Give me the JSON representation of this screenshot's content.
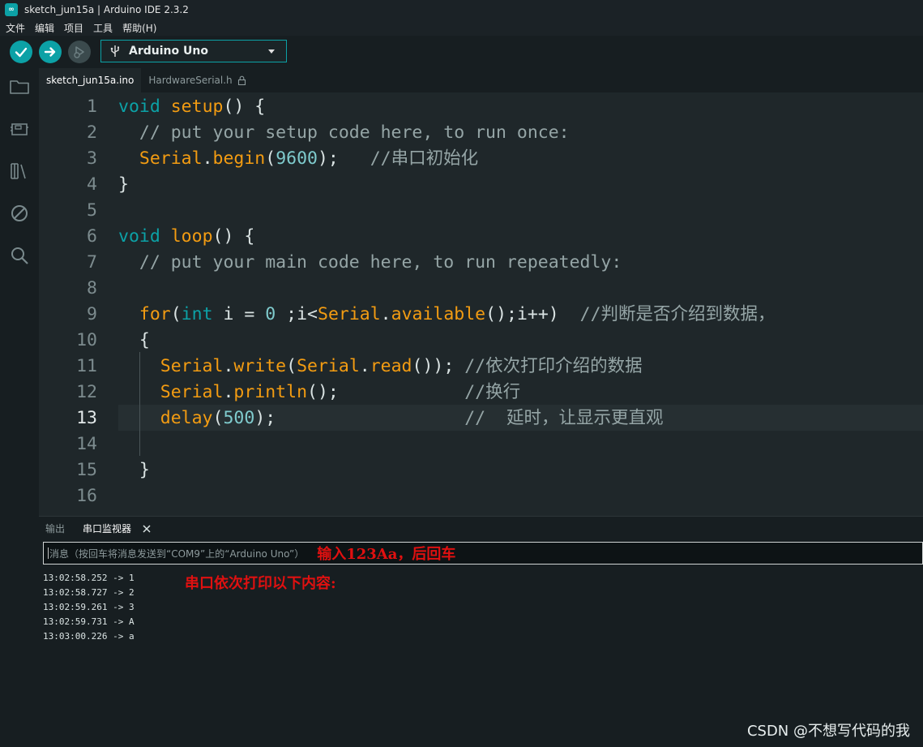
{
  "window": {
    "title": "sketch_jun15a | Arduino IDE 2.3.2"
  },
  "menu": [
    "文件",
    "编辑",
    "项目",
    "工具",
    "帮助(H)"
  ],
  "toolbar": {
    "board": "Arduino Uno"
  },
  "tabs": [
    {
      "label": "sketch_jun15a.ino",
      "active": true
    },
    {
      "label": "HardwareSerial.h",
      "active": false,
      "locked": true
    }
  ],
  "editor": {
    "current_line": 13,
    "lines": [
      [
        [
          "k",
          "void"
        ],
        [
          "p",
          " "
        ],
        [
          "f",
          "setup"
        ],
        [
          "p",
          "() {"
        ]
      ],
      [
        [
          "c",
          "  // put your setup code here, to run once:"
        ]
      ],
      [
        [
          "p",
          "  "
        ],
        [
          "f",
          "Serial"
        ],
        [
          "p",
          "."
        ],
        [
          "f",
          "begin"
        ],
        [
          "p",
          "("
        ],
        [
          "n",
          "9600"
        ],
        [
          "p",
          ");   "
        ],
        [
          "c",
          "//串口初始化"
        ]
      ],
      [
        [
          "p",
          "}"
        ]
      ],
      [],
      [
        [
          "k",
          "void"
        ],
        [
          "p",
          " "
        ],
        [
          "f",
          "loop"
        ],
        [
          "p",
          "() {"
        ]
      ],
      [
        [
          "c",
          "  // put your main code here, to run repeatedly:"
        ]
      ],
      [],
      [
        [
          "p",
          "  "
        ],
        [
          "f",
          "for"
        ],
        [
          "p",
          "("
        ],
        [
          "k",
          "int"
        ],
        [
          "p",
          " i = "
        ],
        [
          "n",
          "0"
        ],
        [
          "p",
          " ;i<"
        ],
        [
          "f",
          "Serial"
        ],
        [
          "p",
          "."
        ],
        [
          "f",
          "available"
        ],
        [
          "p",
          "();i++)  "
        ],
        [
          "c",
          "//判断是否介绍到数据，"
        ]
      ],
      [
        [
          "p",
          "  {"
        ]
      ],
      [
        [
          "p",
          "    "
        ],
        [
          "f",
          "Serial"
        ],
        [
          "p",
          "."
        ],
        [
          "f",
          "write"
        ],
        [
          "p",
          "("
        ],
        [
          "f",
          "Serial"
        ],
        [
          "p",
          "."
        ],
        [
          "f",
          "read"
        ],
        [
          "p",
          "()); "
        ],
        [
          "c",
          "//依次打印介绍的数据"
        ]
      ],
      [
        [
          "p",
          "    "
        ],
        [
          "f",
          "Serial"
        ],
        [
          "p",
          "."
        ],
        [
          "f",
          "println"
        ],
        [
          "p",
          "();            "
        ],
        [
          "c",
          "//换行"
        ]
      ],
      [
        [
          "p",
          "    "
        ],
        [
          "f",
          "delay"
        ],
        [
          "p",
          "("
        ],
        [
          "n",
          "500"
        ],
        [
          "p",
          ");                  "
        ],
        [
          "c",
          "//  延时，让显示更直观"
        ]
      ],
      [],
      [
        [
          "p",
          "  }"
        ]
      ],
      []
    ]
  },
  "panel": {
    "tab_output": "输出",
    "tab_serial": "串口监视器",
    "input_placeholder": "消息（按回车将消息发送到“COM9”上的“Arduino Uno”）",
    "annotation_input": "输入123Aa，后回车",
    "annotation_output": "串口依次打印以下内容:",
    "output_lines": [
      "13:02:58.252 -> 1",
      "13:02:58.727 -> 2",
      "13:02:59.261 -> 3",
      "13:02:59.731 -> A",
      "13:03:00.226 -> a"
    ]
  },
  "watermark": "CSDN @不想写代码的我",
  "colors": {
    "accent": "#0ca1a6",
    "keyword": "#0ca1a6",
    "function": "#f39c12",
    "comment": "#95a5a6",
    "number": "#7fcbcd",
    "annotation": "#e01010"
  }
}
